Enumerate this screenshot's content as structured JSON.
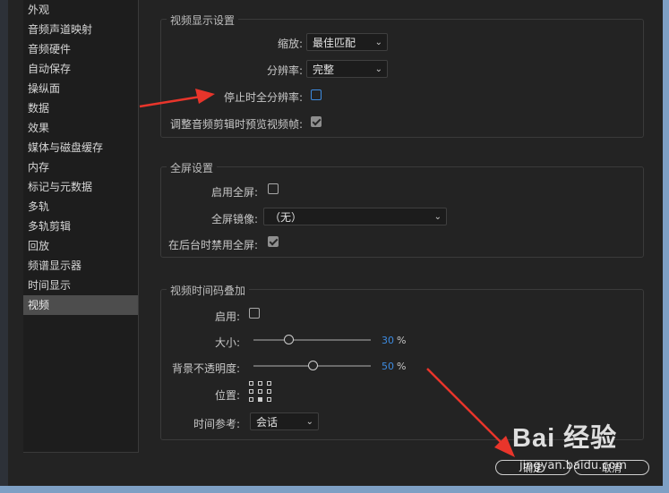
{
  "sidebar": {
    "items": [
      {
        "label": "外观"
      },
      {
        "label": "音频声道映射"
      },
      {
        "label": "音频硬件"
      },
      {
        "label": "自动保存"
      },
      {
        "label": "操纵面"
      },
      {
        "label": "数据"
      },
      {
        "label": "效果"
      },
      {
        "label": "媒体与磁盘缓存"
      },
      {
        "label": "内存"
      },
      {
        "label": "标记与元数据"
      },
      {
        "label": "多轨"
      },
      {
        "label": "多轨剪辑"
      },
      {
        "label": "回放"
      },
      {
        "label": "频谱显示器"
      },
      {
        "label": "时间显示"
      },
      {
        "label": "视频",
        "active": true
      }
    ]
  },
  "video_display": {
    "title": "视频显示设置",
    "zoom_label": "缩放:",
    "zoom_value": "最佳匹配",
    "resolution_label": "分辨率:",
    "resolution_value": "完整",
    "full_res_stop_label": "停止时全分辨率:",
    "full_res_stop_checked": false,
    "preview_frames_label": "调整音频剪辑时预览视频帧:",
    "preview_frames_checked": true
  },
  "fullscreen": {
    "title": "全屏设置",
    "enable_label": "启用全屏:",
    "enable_checked": false,
    "mirror_label": "全屏镜像:",
    "mirror_value": "（无）",
    "disable_bg_label": "在后台时禁用全屏:",
    "disable_bg_checked": true
  },
  "timecode": {
    "title": "视频时间码叠加",
    "enable_label": "启用:",
    "enable_checked": false,
    "size_label": "大小:",
    "size_value": "30",
    "size_percent": 30,
    "opacity_label": "背景不透明度:",
    "opacity_value": "50",
    "opacity_percent": 50,
    "unit": "%",
    "position_label": "位置:",
    "time_ref_label": "时间参考:",
    "time_ref_value": "会话"
  },
  "footer": {
    "ok_label": "确定",
    "cancel_label": "取消"
  },
  "watermark": {
    "brand": "Bai 经验",
    "url": "jingyan.baidu.com"
  },
  "colors": {
    "accent": "#3d8be0",
    "annotation": "#e8352b"
  }
}
